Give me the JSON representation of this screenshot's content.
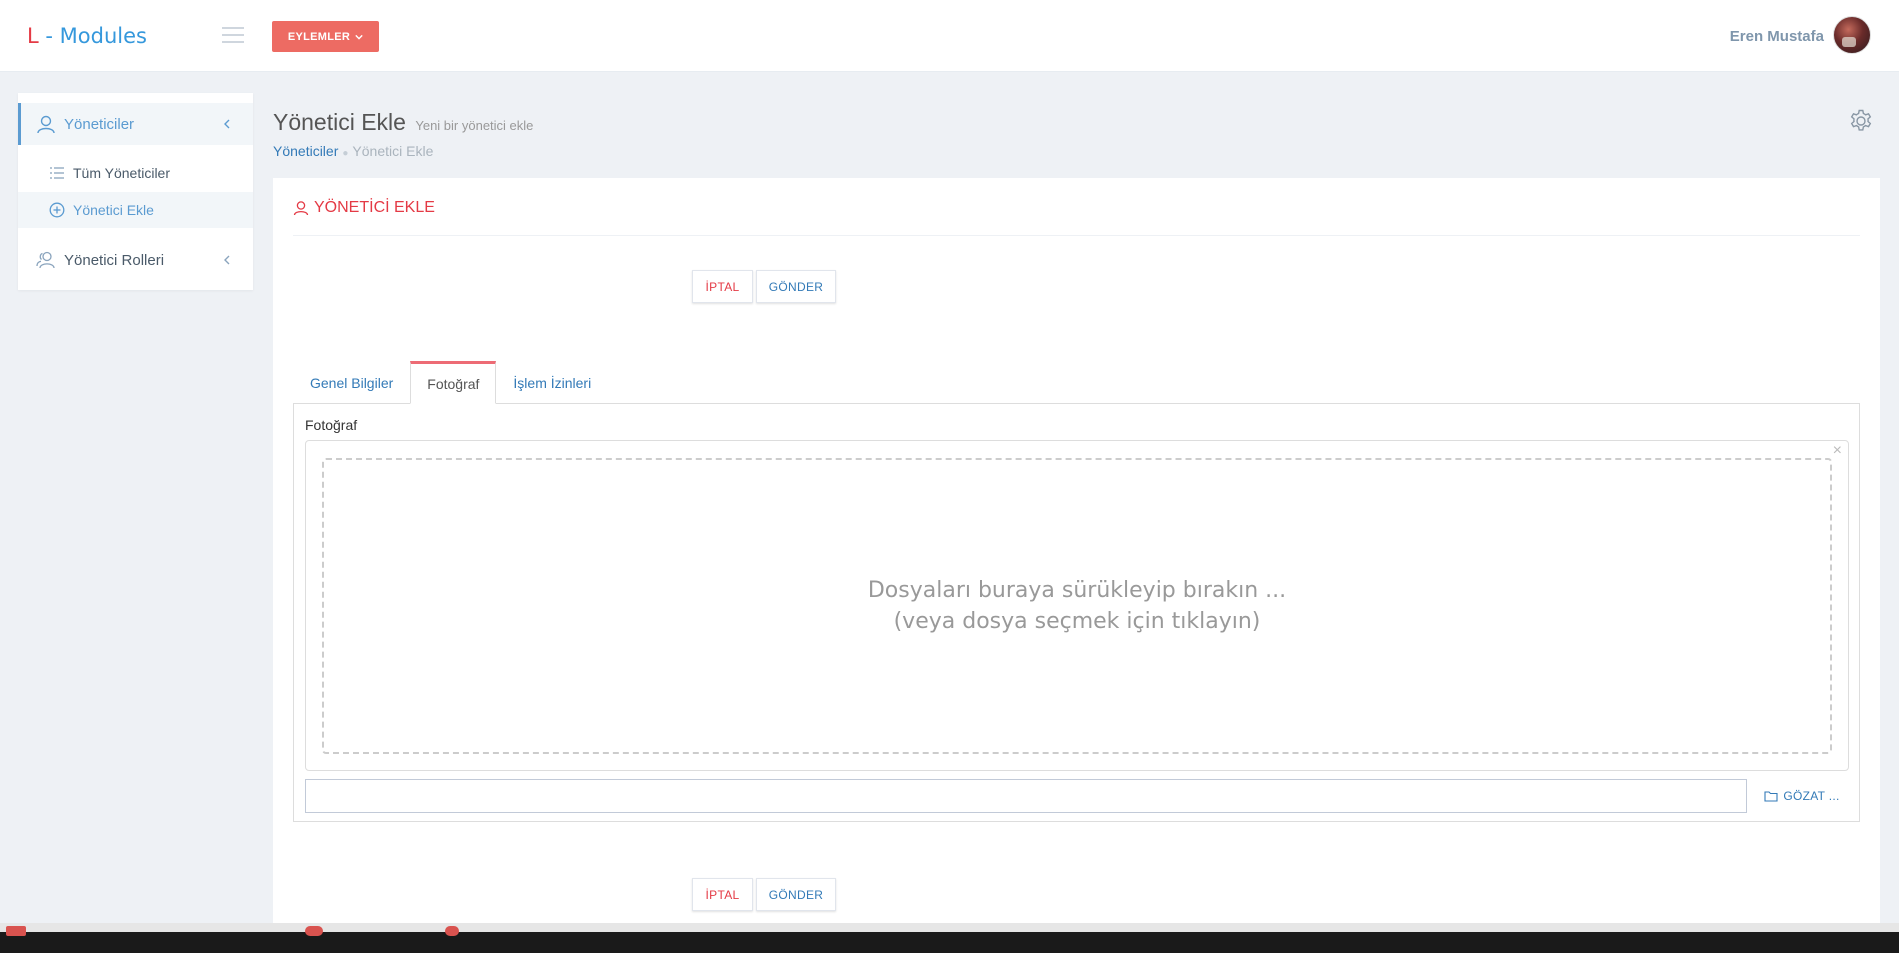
{
  "header": {
    "logo_prefix": "L",
    "logo_dash": " - ",
    "logo_name": "Modules",
    "actions_label": "EYLEMLER",
    "user_name": "Eren Mustafa"
  },
  "sidebar": {
    "items": [
      {
        "label": "Yöneticiler",
        "icon": "user-icon"
      },
      {
        "label": "Tüm Yöneticiler",
        "icon": "list-icon"
      },
      {
        "label": "Yönetici Ekle",
        "icon": "plus-circle-icon"
      },
      {
        "label": "Yönetici Rolleri",
        "icon": "users-icon"
      }
    ]
  },
  "page": {
    "title": "Yönetici Ekle",
    "subtitle": "Yeni bir yönetici ekle",
    "breadcrumb": [
      "Yöneticiler",
      "Yönetici Ekle"
    ]
  },
  "portlet": {
    "title": "YÖNETİCİ EKLE",
    "cancel_label": "İPTAL",
    "submit_label": "GÖNDER",
    "tabs": [
      "Genel Bilgiler",
      "Fotoğraf",
      "İşlem İzinleri"
    ],
    "active_tab": "Fotoğraf",
    "field_label": "Fotoğraf",
    "dropzone_line1": "Dosyaları buraya sürükleyip bırakın ...",
    "dropzone_line2": "(veya dosya seçmek için tıklayın)",
    "browse_label": "GÖZAT ..."
  },
  "colors": {
    "accent_red": "#e43a45",
    "accent_blue": "#337ab7",
    "actions_button": "#ed6b63",
    "background": "#eef1f5"
  }
}
